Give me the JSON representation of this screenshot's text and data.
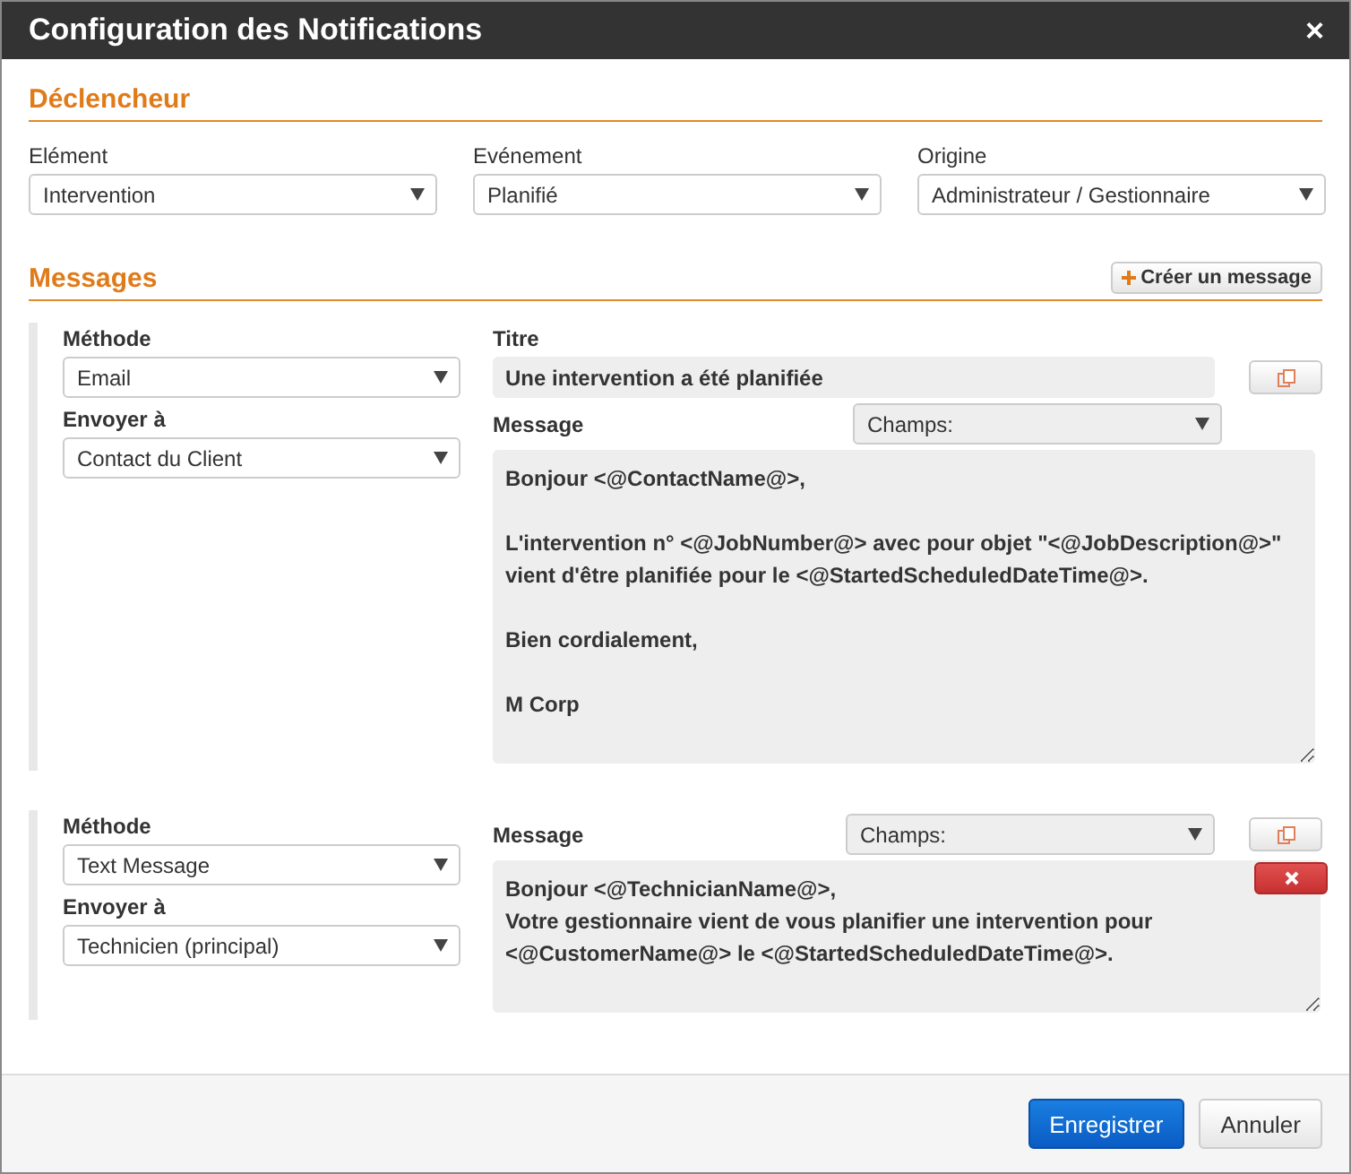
{
  "window": {
    "title": "Configuration des Notifications",
    "close": "×"
  },
  "trigger": {
    "heading": "Déclencheur",
    "fields": [
      {
        "label": "Elément",
        "value": "Intervention"
      },
      {
        "label": "Evénement",
        "value": "Planifié"
      },
      {
        "label": "Origine",
        "value": "Administrateur / Gestionnaire"
      }
    ]
  },
  "messages": {
    "heading": "Messages",
    "create_button": "Créer un message",
    "items": [
      {
        "method_label": "Méthode",
        "method": "Email",
        "recipient_label": "Envoyer à",
        "recipient": "Contact du Client",
        "title_label": "Titre",
        "title": "Une intervention a été planifiée",
        "message_label": "Message",
        "fields_select": "Champs:",
        "body": "Bonjour <@ContactName@>,\n\nL'intervention n° <@JobNumber@> avec pour objet \"<@JobDescription@>\" vient d'être planifiée pour le <@StartedScheduledDateTime@>.\n\nBien cordialement,\n\nM Corp",
        "deletable": false
      },
      {
        "method_label": "Méthode",
        "method": "Text Message",
        "recipient_label": "Envoyer à",
        "recipient": "Technicien (principal)",
        "message_label": "Message",
        "fields_select": "Champs:",
        "body": "Bonjour <@TechnicianName@>,\nVotre gestionnaire vient de vous planifier une intervention pour <@CustomerName@> le <@StartedScheduledDateTime@>.",
        "deletable": true
      }
    ]
  },
  "buttons": [
    {
      "label": "Enregistrer",
      "kind": "primary"
    },
    {
      "label": "Annuler",
      "kind": "default"
    }
  ]
}
